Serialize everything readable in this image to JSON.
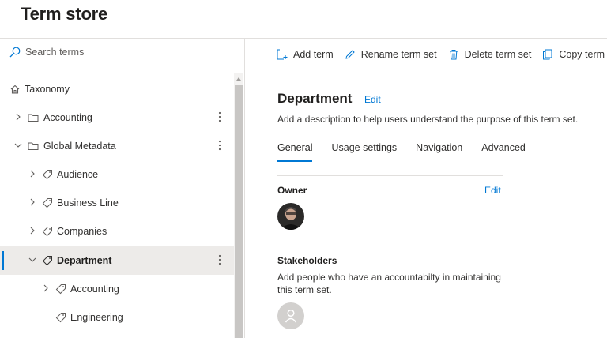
{
  "page": {
    "title": "Term store"
  },
  "search": {
    "placeholder": "Search terms"
  },
  "tree": {
    "root_label": "Taxonomy",
    "items": [
      {
        "label": "Accounting",
        "icon": "folder-icon",
        "expander": "chevron-right"
      },
      {
        "label": "Global Metadata",
        "icon": "folder-icon",
        "expander": "chevron-down"
      },
      {
        "label": "Audience",
        "icon": "tag-icon",
        "expander": "chevron-right"
      },
      {
        "label": "Business Line",
        "icon": "tag-icon",
        "expander": "chevron-right"
      },
      {
        "label": "Companies",
        "icon": "tag-icon",
        "expander": "chevron-right"
      },
      {
        "label": "Department",
        "icon": "tag-icon",
        "expander": "chevron-down",
        "selected": true
      },
      {
        "label": "Accounting",
        "icon": "tag-icon",
        "expander": "chevron-right"
      },
      {
        "label": "Engineering",
        "icon": "tag-icon",
        "expander": "none"
      }
    ]
  },
  "toolbar": {
    "add_term": "Add term",
    "rename_term_set": "Rename term set",
    "delete_term_set": "Delete term set",
    "copy_term_set": "Copy term set"
  },
  "term_set": {
    "title": "Department",
    "edit_label": "Edit",
    "description": "Add a description to help users understand the purpose of this term set."
  },
  "tabs": [
    {
      "label": "General",
      "active": true
    },
    {
      "label": "Usage settings"
    },
    {
      "label": "Navigation"
    },
    {
      "label": "Advanced"
    }
  ],
  "owner": {
    "label": "Owner",
    "edit_label": "Edit"
  },
  "stakeholders": {
    "label": "Stakeholders",
    "description": "Add people who have an accountabilty in maintaining this term set."
  },
  "colors": {
    "accent": "#0078d4",
    "selected_row": "#edebe9"
  }
}
